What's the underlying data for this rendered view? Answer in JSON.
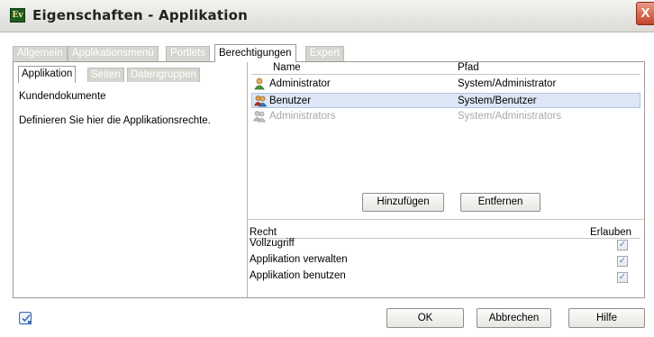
{
  "window": {
    "title": "Eigenschaften - Applikation",
    "icon_text": "Ev",
    "close_glyph": "X"
  },
  "tabs": [
    {
      "label": "Allgemein"
    },
    {
      "label": "Applikationsmenü"
    },
    {
      "label": "Portlets"
    },
    {
      "label": "Berechtigungen"
    },
    {
      "label": "Expert"
    }
  ],
  "subtabs": [
    {
      "label": "Applikation"
    },
    {
      "label": "Seiten"
    },
    {
      "label": "Datengruppen"
    }
  ],
  "left_panel": {
    "title": "Kundendokumente",
    "description": "Definieren Sie hier die Applikationsrechte."
  },
  "users_table": {
    "columns": {
      "name": "Name",
      "path": "Pfad"
    },
    "rows": [
      {
        "name": "Administrator",
        "path": "System/Administrator",
        "icon": "user-icon"
      },
      {
        "name": "Benutzer",
        "path": "System/Benutzer",
        "icon": "users-group-icon"
      },
      {
        "name": "Administrators",
        "path": "System/Administrators",
        "icon": "users-group-icon"
      }
    ]
  },
  "buttons": {
    "add": "Hinzufügen",
    "remove": "Entfernen"
  },
  "rights_table": {
    "columns": {
      "right": "Recht",
      "allow": "Erlauben"
    },
    "rows": [
      {
        "label": "Vollzugriff",
        "checked": true
      },
      {
        "label": "Applikation verwalten",
        "checked": true
      },
      {
        "label": "Applikation benutzen",
        "checked": true
      }
    ],
    "check_glyph": "✓"
  },
  "footer": {
    "ok": "OK",
    "cancel": "Abbrechen",
    "help": "Hilfe"
  }
}
